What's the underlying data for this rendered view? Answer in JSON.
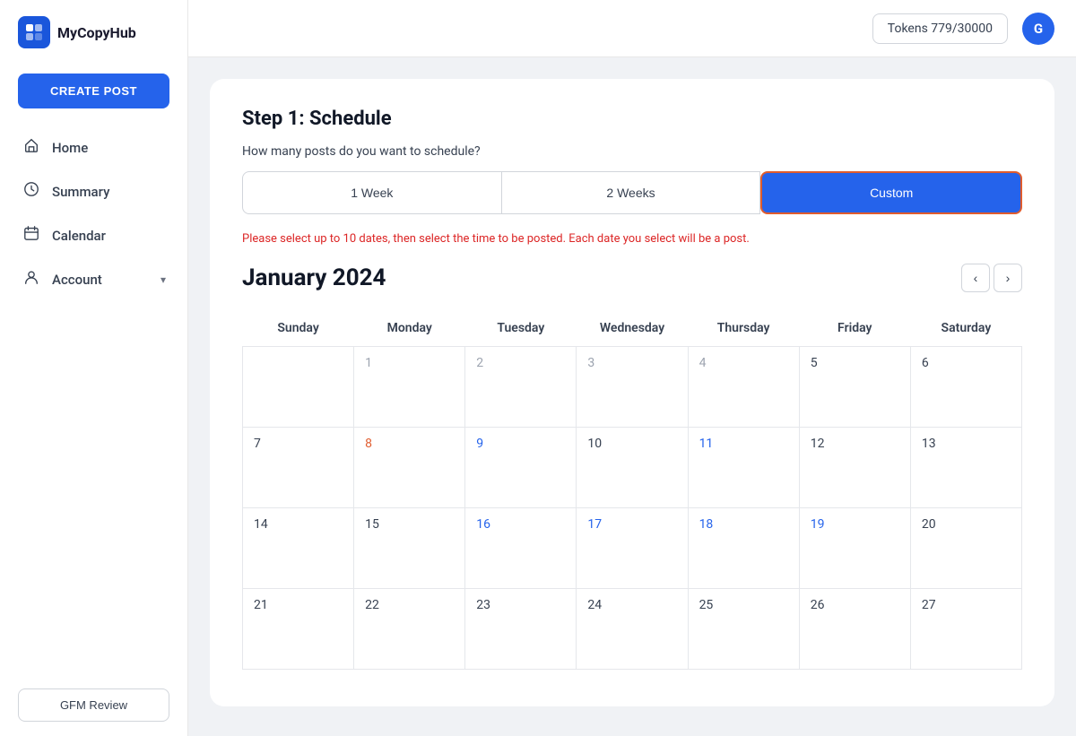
{
  "app": {
    "logo_text": "MyCopyHub",
    "logo_icon": "M"
  },
  "header": {
    "tokens_label": "Tokens 779/30000",
    "user_initial": "G"
  },
  "sidebar": {
    "create_post_label": "CREATE POST",
    "nav_items": [
      {
        "id": "home",
        "label": "Home",
        "icon": "🏠"
      },
      {
        "id": "summary",
        "label": "Summary",
        "icon": "📋"
      },
      {
        "id": "calendar",
        "label": "Calendar",
        "icon": "📅"
      },
      {
        "id": "account",
        "label": "Account",
        "icon": "👤"
      }
    ],
    "gfm_label": "GFM Review"
  },
  "main": {
    "step_title": "Step 1: Schedule",
    "schedule_question": "How many posts do you want to schedule?",
    "schedule_options": [
      {
        "id": "1week",
        "label": "1 Week",
        "active": false
      },
      {
        "id": "2weeks",
        "label": "2 Weeks",
        "active": false
      },
      {
        "id": "custom",
        "label": "Custom",
        "active": true
      }
    ],
    "info_text": "Please select up to 10 dates, then select the time to be posted. Each date you select will be a post.",
    "calendar_month": "January 2024",
    "calendar_days": [
      "Sunday",
      "Monday",
      "Tuesday",
      "Wednesday",
      "Thursday",
      "Friday",
      "Saturday"
    ],
    "calendar_weeks": [
      [
        {
          "day": "",
          "color": "empty"
        },
        {
          "day": "1",
          "color": "gray"
        },
        {
          "day": "2",
          "color": "gray"
        },
        {
          "day": "3",
          "color": "gray"
        },
        {
          "day": "4",
          "color": "gray"
        },
        {
          "day": "5",
          "color": "normal"
        },
        {
          "day": "6",
          "color": "normal"
        }
      ],
      [
        {
          "day": "7",
          "color": "normal"
        },
        {
          "day": "8",
          "color": "orange"
        },
        {
          "day": "9",
          "color": "blue"
        },
        {
          "day": "10",
          "color": "normal"
        },
        {
          "day": "11",
          "color": "blue"
        },
        {
          "day": "12",
          "color": "normal"
        },
        {
          "day": "13",
          "color": "normal"
        }
      ],
      [
        {
          "day": "14",
          "color": "normal"
        },
        {
          "day": "15",
          "color": "normal"
        },
        {
          "day": "16",
          "color": "blue"
        },
        {
          "day": "17",
          "color": "blue"
        },
        {
          "day": "18",
          "color": "blue"
        },
        {
          "day": "19",
          "color": "blue"
        },
        {
          "day": "20",
          "color": "normal"
        }
      ],
      [
        {
          "day": "21",
          "color": "normal"
        },
        {
          "day": "22",
          "color": "normal"
        },
        {
          "day": "23",
          "color": "normal"
        },
        {
          "day": "24",
          "color": "normal"
        },
        {
          "day": "25",
          "color": "normal"
        },
        {
          "day": "26",
          "color": "normal"
        },
        {
          "day": "27",
          "color": "normal"
        }
      ]
    ]
  }
}
